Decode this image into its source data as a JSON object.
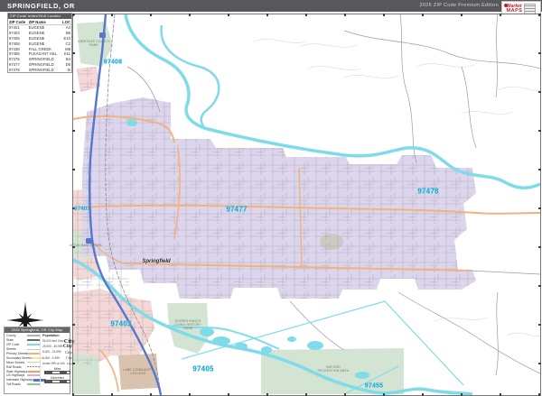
{
  "header": {
    "title": "SPRINGFIELD, OR",
    "edition": "2026 ZIP Code Premium Edition",
    "logo_market": "Market",
    "logo_maps": "MAPS"
  },
  "zip_table": {
    "title": "ZIP Code Index/Grid Locator",
    "columns": [
      "ZIP Code",
      "ZIP Name",
      "LOC"
    ],
    "rows": [
      {
        "code": "97401",
        "name": "EUGENE",
        "loc": "A4"
      },
      {
        "code": "97403",
        "name": "EUGENE",
        "loc": "B6"
      },
      {
        "code": "97405",
        "name": "EUGENE",
        "loc": "E10"
      },
      {
        "code": "97408",
        "name": "EUGENE",
        "loc": "C2"
      },
      {
        "code": "97438",
        "name": "FALL CREEK",
        "loc": "M9"
      },
      {
        "code": "97455",
        "name": "PLEASANT HILL",
        "loc": "K11"
      },
      {
        "code": "97475",
        "name": "SPRINGFIELD",
        "loc": "B4"
      },
      {
        "code": "97477",
        "name": "SPRINGFIELD",
        "loc": "D6"
      },
      {
        "code": "97478",
        "name": "SPRINGFIELD",
        "loc": "I6"
      }
    ]
  },
  "map": {
    "zip_labels": [
      {
        "text": "97408"
      },
      {
        "text": "97401"
      },
      {
        "text": "97477"
      },
      {
        "text": "97478"
      },
      {
        "text": "97403"
      },
      {
        "text": "97405"
      },
      {
        "text": "97455"
      }
    ],
    "city_labels": [
      {
        "text": "Springfield"
      }
    ],
    "place_labels": [
      {
        "text": "ARMITAGE COUNTY PARK"
      },
      {
        "text": "ALTON BAKER PARK"
      },
      {
        "text": "DORRIS RANCH LIVING HISTORY FARM"
      },
      {
        "text": "LANE COMMUNITY COLLEGE"
      },
      {
        "text": "BUFORD RECREATION AREA"
      }
    ]
  },
  "legend": {
    "title": "2026 Springfield, OR City Map",
    "items": [
      {
        "label": "County"
      },
      {
        "label": "State"
      },
      {
        "label": "ZIP Code"
      },
      {
        "label": "Streets"
      },
      {
        "label": "Primary Streets"
      },
      {
        "label": "Secondary Streets"
      },
      {
        "label": "Minor Streets"
      },
      {
        "label": "Rail Roads"
      },
      {
        "label": "State Highways"
      },
      {
        "label": "US Highways"
      },
      {
        "label": "Interstate Highways"
      },
      {
        "label": "Toll Roads"
      }
    ],
    "population": {
      "header": "Population",
      "entries": [
        {
          "label": "50,000 and Over",
          "sample": "City"
        },
        {
          "label": "25,000 - 49,999",
          "sample": "City"
        },
        {
          "label": "5,000 - 24,999",
          "sample": "City"
        },
        {
          "label": "1,000 - 4,999",
          "sample": "City"
        },
        {
          "label": "Under 999 or N/A",
          "sample": "City"
        }
      ]
    },
    "scale": {
      "miles_label": "Miles",
      "km_label": "Kilometers"
    }
  },
  "colors": {
    "header_bg": "#58585c",
    "urban": "#ddd5ee",
    "pink": "#f4d7d6",
    "green": "#d3e5d2",
    "tan": "#d9c3ae",
    "water": "#7fdbea",
    "zip_label": "#00aedd",
    "interstate": "#5577cc",
    "hwy_orange": "#f2b27a",
    "street_gray": "#ababab"
  }
}
